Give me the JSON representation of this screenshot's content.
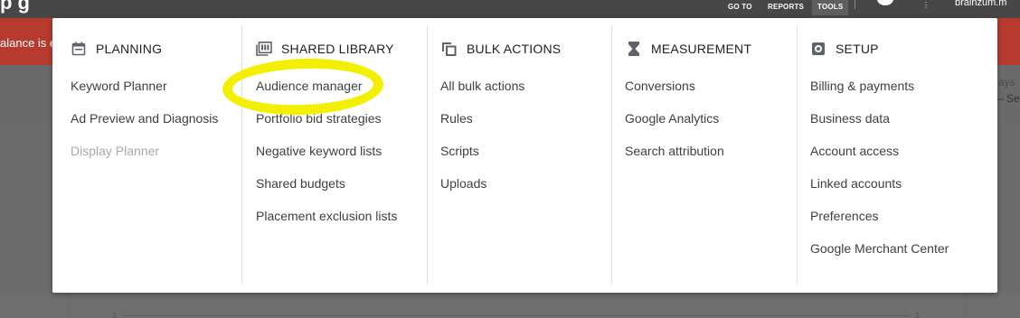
{
  "top_nav": {
    "title_fragment": "p g",
    "goto": "GO TO",
    "reports": "REPORTS",
    "tools": "TOOLS",
    "user_fragment": "brainzum.m"
  },
  "alert": {
    "text_fragment": "alance is e"
  },
  "background": {
    "right_fragment_1": "ays",
    "right_fragment_2": "– Se",
    "chart_tick_left": "1",
    "chart_tick_right": "1"
  },
  "tools_menu": {
    "columns": [
      {
        "heading": "PLANNING",
        "icon": "calendar-icon",
        "items": [
          {
            "label": "Keyword Planner",
            "disabled": false
          },
          {
            "label": "Ad Preview and Diagnosis",
            "disabled": false
          },
          {
            "label": "Display Planner",
            "disabled": true
          }
        ]
      },
      {
        "heading": "SHARED LIBRARY",
        "icon": "library-icon",
        "items": [
          {
            "label": "Audience manager",
            "disabled": false
          },
          {
            "label": "Portfolio bid strategies",
            "disabled": false
          },
          {
            "label": "Negative keyword lists",
            "disabled": false
          },
          {
            "label": "Shared budgets",
            "disabled": false
          },
          {
            "label": "Placement exclusion lists",
            "disabled": false
          }
        ]
      },
      {
        "heading": "BULK ACTIONS",
        "icon": "copy-stack-icon",
        "items": [
          {
            "label": "All bulk actions",
            "disabled": false
          },
          {
            "label": "Rules",
            "disabled": false
          },
          {
            "label": "Scripts",
            "disabled": false
          },
          {
            "label": "Uploads",
            "disabled": false
          }
        ]
      },
      {
        "heading": "MEASUREMENT",
        "icon": "hourglass-icon",
        "items": [
          {
            "label": "Conversions",
            "disabled": false
          },
          {
            "label": "Google Analytics",
            "disabled": false
          },
          {
            "label": "Search attribution",
            "disabled": false
          }
        ]
      },
      {
        "heading": "SETUP",
        "icon": "gear-icon",
        "items": [
          {
            "label": "Billing & payments",
            "disabled": false
          },
          {
            "label": "Business data",
            "disabled": false
          },
          {
            "label": "Account access",
            "disabled": false
          },
          {
            "label": "Linked accounts",
            "disabled": false
          },
          {
            "label": "Preferences",
            "disabled": false
          },
          {
            "label": "Google Merchant Center",
            "disabled": false
          }
        ]
      }
    ]
  },
  "colors": {
    "highlight": "#f2f000",
    "alert": "#b73a2f",
    "disabled_text": "#a8a8a8"
  }
}
